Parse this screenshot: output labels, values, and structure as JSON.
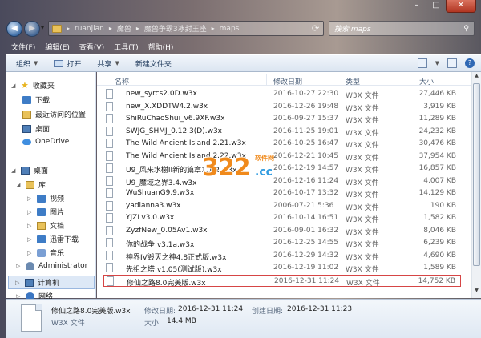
{
  "address": {
    "crumbs": [
      "ruanjian",
      "魔兽",
      "魔兽争霸3冰封王座",
      "maps"
    ],
    "search_placeholder": "搜索 maps"
  },
  "menu": [
    "文件(F)",
    "编辑(E)",
    "查看(V)",
    "工具(T)",
    "帮助(H)"
  ],
  "toolbar": {
    "organize": "组织",
    "open": "打开",
    "share": "共享",
    "new_folder": "新建文件夹"
  },
  "nav": {
    "favorites": "收藏夹",
    "downloads": "下载",
    "recent": "最近访问的位置",
    "desktop1": "桌面",
    "onedrive": "OneDrive",
    "desktop2": "桌面",
    "libraries": "库",
    "videos": "视频",
    "pictures": "图片",
    "documents": "文档",
    "thunder": "迅雷下载",
    "music": "音乐",
    "admin": "Administrator",
    "computer": "计算机",
    "network": "网络"
  },
  "columns": {
    "name": "名称",
    "date": "修改日期",
    "type": "类型",
    "size": "大小"
  },
  "files": [
    {
      "name": "new_syrcs2.0D.w3x",
      "date": "2016-10-27 22:30",
      "type": "W3X 文件",
      "size": "27,446 KB"
    },
    {
      "name": "new_X.XDDTW4.2.w3x",
      "date": "2016-12-26 19:48",
      "type": "W3X 文件",
      "size": "3,919 KB"
    },
    {
      "name": "ShiRuChaoShui_v6.9XF.w3x",
      "date": "2016-09-27 15:37",
      "type": "W3X 文件",
      "size": "11,289 KB"
    },
    {
      "name": "SWJG_SHMJ_0.12.3(D).w3x",
      "date": "2016-11-25 19:01",
      "type": "W3X 文件",
      "size": "24,232 KB"
    },
    {
      "name": "The Wild Ancient Island 2.21.w3x",
      "date": "2016-10-25 16:47",
      "type": "W3X 文件",
      "size": "30,476 KB"
    },
    {
      "name": "The Wild Ancient Island 2.22.w3x",
      "date": "2016-12-21 10:45",
      "type": "W3X 文件",
      "size": "37,954 KB"
    },
    {
      "name": "U9_风来水榭II新的篇章1.1.2.w3x",
      "date": "2016-12-19 14:57",
      "type": "W3X 文件",
      "size": "16,857 KB"
    },
    {
      "name": "U9_魔域之界3.4.w3x",
      "date": "2016-12-16 11:24",
      "type": "W3X 文件",
      "size": "4,007 KB"
    },
    {
      "name": "WuShuanG9.9.w3x",
      "date": "2016-10-17 13:32",
      "type": "W3X 文件",
      "size": "14,129 KB"
    },
    {
      "name": "yadianna3.w3x",
      "date": "2006-07-21 5:36",
      "type": "W3X 文件",
      "size": "190 KB"
    },
    {
      "name": "YJZLv3.0.w3x",
      "date": "2016-10-14 16:51",
      "type": "W3X 文件",
      "size": "1,582 KB"
    },
    {
      "name": "ZyzfNew_0.05Av1.w3x",
      "date": "2016-09-01 16:32",
      "type": "W3X 文件",
      "size": "8,046 KB"
    },
    {
      "name": "你的战争 v3.1a.w3x",
      "date": "2016-12-25 14:55",
      "type": "W3X 文件",
      "size": "6,239 KB"
    },
    {
      "name": "神界IV毁灭之神4.8正式版.w3x",
      "date": "2016-12-29 14:32",
      "type": "W3X 文件",
      "size": "4,690 KB"
    },
    {
      "name": "先祖之塔 v1.05(测试版).w3x",
      "date": "2016-12-19 11:02",
      "type": "W3X 文件",
      "size": "1,589 KB"
    },
    {
      "name": "修仙之路8.0完美版.w3x",
      "date": "2016-12-31 11:24",
      "type": "W3X 文件",
      "size": "14,752 KB"
    }
  ],
  "details": {
    "name": "修仙之路8.0完美版.w3x",
    "modified_label": "修改日期:",
    "modified": "2016-12-31 11:24",
    "created_label": "创建日期:",
    "created": "2016-12-31 11:23",
    "type": "W3X 文件",
    "size_label": "大小:",
    "size": "14.4 MB"
  },
  "watermark": {
    "number": "322",
    "cc": ".cc",
    "text": "软件网"
  }
}
